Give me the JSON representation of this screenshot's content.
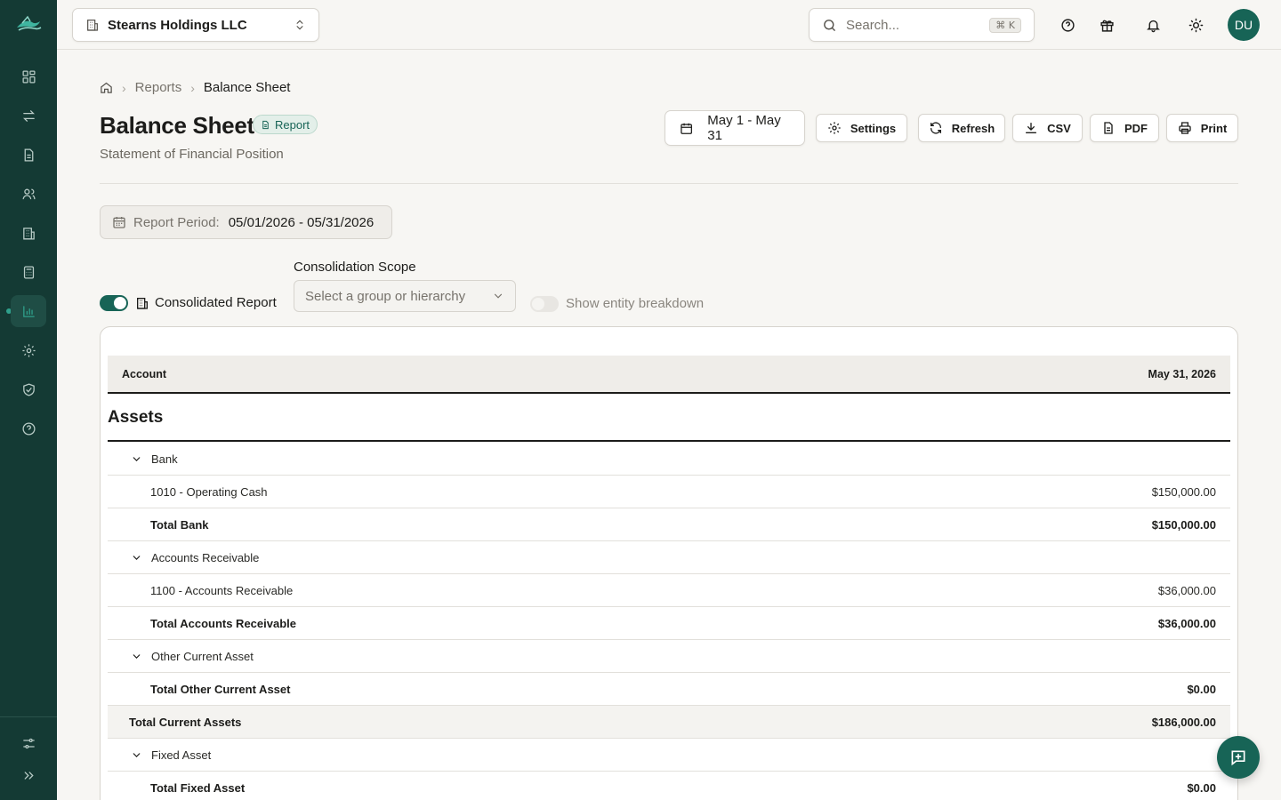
{
  "company": {
    "name": "Stearns Holdings LLC"
  },
  "search": {
    "placeholder": "Search...",
    "shortcut": "⌘ K"
  },
  "user": {
    "initials": "DU"
  },
  "breadcrumb": {
    "home_icon": "home-icon",
    "reports": "Reports",
    "current": "Balance Sheet"
  },
  "page": {
    "title": "Balance Sheet",
    "badge": "Report",
    "subtitle": "Statement of Financial Position"
  },
  "actions": {
    "date_range": "May 1 - May 31",
    "settings": "Settings",
    "refresh": "Refresh",
    "csv": "CSV",
    "pdf": "PDF",
    "print": "Print"
  },
  "period": {
    "label": "Report Period:",
    "value": "05/01/2026 - 05/31/2026"
  },
  "controls": {
    "consolidated_label": "Consolidated Report",
    "consolidated_on": true,
    "scope_label": "Consolidation Scope",
    "scope_placeholder": "Select a group or hierarchy",
    "breakdown_label": "Show entity breakdown",
    "breakdown_on": false
  },
  "table": {
    "col_account": "Account",
    "col_date": "May 31, 2026",
    "section": "Assets",
    "rows": [
      {
        "type": "group",
        "label": "Bank",
        "amount": ""
      },
      {
        "type": "item",
        "label": "1010 - Operating Cash",
        "amount": "$150,000.00"
      },
      {
        "type": "total",
        "label": "Total Bank",
        "amount": "$150,000.00"
      },
      {
        "type": "group",
        "label": "Accounts Receivable",
        "amount": ""
      },
      {
        "type": "item",
        "label": "1100 - Accounts Receivable",
        "amount": "$36,000.00"
      },
      {
        "type": "total",
        "label": "Total Accounts Receivable",
        "amount": "$36,000.00"
      },
      {
        "type": "group",
        "label": "Other Current Asset",
        "amount": ""
      },
      {
        "type": "total",
        "label": "Total Other Current Asset",
        "amount": "$0.00"
      },
      {
        "type": "grand",
        "label": "Total Current Assets",
        "amount": "$186,000.00"
      },
      {
        "type": "group",
        "label": "Fixed Asset",
        "amount": ""
      },
      {
        "type": "total",
        "label": "Total Fixed Asset",
        "amount": "$0.00"
      }
    ]
  },
  "sidebar": {
    "items": [
      {
        "icon": "dashboard-icon"
      },
      {
        "icon": "transfer-icon"
      },
      {
        "icon": "document-icon"
      },
      {
        "icon": "users-icon"
      },
      {
        "icon": "building-icon"
      },
      {
        "icon": "calculator-icon"
      },
      {
        "icon": "chart-icon",
        "active": true
      },
      {
        "icon": "gear-icon"
      },
      {
        "icon": "shield-icon"
      },
      {
        "icon": "help-icon"
      }
    ],
    "bottom": [
      {
        "icon": "sliders-icon"
      },
      {
        "icon": "expand-icon"
      }
    ]
  },
  "colors": {
    "sidebar": "#143a34",
    "accent": "#176456",
    "background": "#f7f6f3"
  }
}
